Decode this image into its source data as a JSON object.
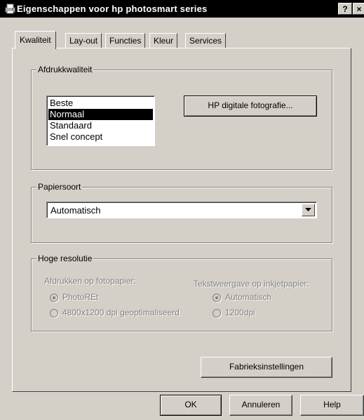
{
  "window": {
    "title": "Eigenschappen voor hp photosmart series",
    "help_button": "?",
    "close_button": "×"
  },
  "tabs": [
    "Kwaliteit",
    "Lay-out",
    "Functies",
    "Kleur",
    "Services"
  ],
  "active_tab": "Kwaliteit",
  "print_quality": {
    "legend": "Afdrukkwaliteit",
    "options": [
      "Beste",
      "Normaal",
      "Standaard",
      "Snel concept"
    ],
    "selected": "Normaal",
    "hp_photo_button": "HP digitale fotografie..."
  },
  "paper_type": {
    "legend": "Papiersoort",
    "value": "Automatisch"
  },
  "high_resolution": {
    "legend": "Hoge resolutie",
    "photo_paper_label": "Afdrukken op fotopapier:",
    "photo_options": [
      "PhotoREt",
      "4800x1200 dpi geoptimaliseerd"
    ],
    "text_label": "Tekstweergave op inkjetpapier:",
    "text_options": [
      "Automatisch",
      "1200dpi"
    ]
  },
  "defaults_button": "Fabrieksinstellingen",
  "footer": {
    "ok": "OK",
    "cancel": "Annuleren",
    "help": "Help"
  }
}
